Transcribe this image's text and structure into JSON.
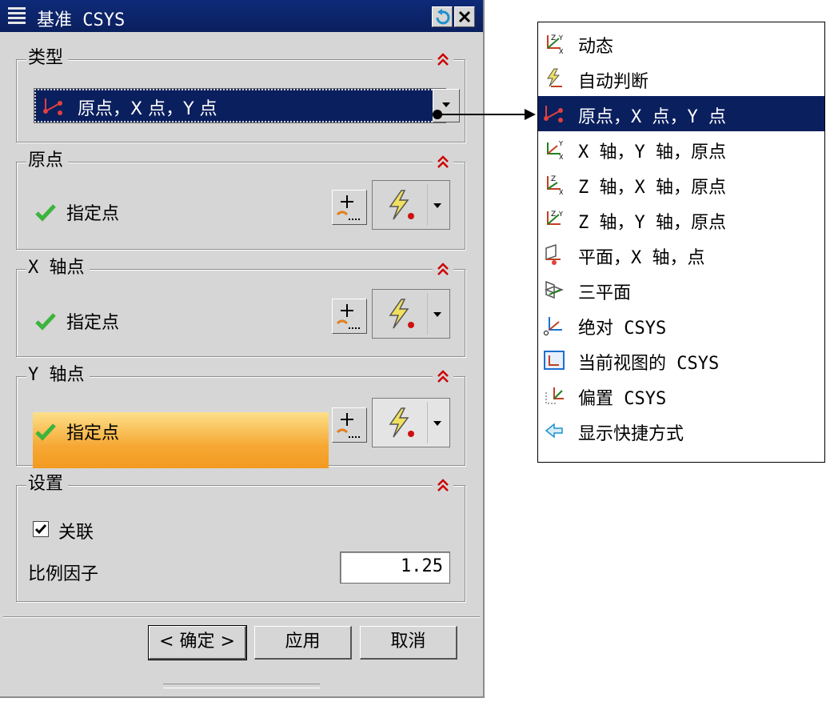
{
  "dialog": {
    "title": "基准 CSYS",
    "type_group": {
      "label": "类型",
      "selected": "原点，X 点，Y 点"
    },
    "origin_group": {
      "label": "原点",
      "row_label": "指定点"
    },
    "xaxis_group": {
      "label": "X 轴点",
      "row_label": "指定点"
    },
    "yaxis_group": {
      "label": "Y 轴点",
      "row_label": "指定点"
    },
    "settings_group": {
      "label": "设置",
      "associative_label": "关联",
      "associative_checked": true,
      "scale_label": "比例因子",
      "scale_value": "1.25"
    },
    "buttons": {
      "ok": "< 确定 >",
      "apply": "应用",
      "cancel": "取消"
    }
  },
  "type_dropdown": {
    "items": [
      {
        "label": "动态",
        "icon": "dynamic-csys-icon"
      },
      {
        "label": "自动判断",
        "icon": "inferred-icon"
      },
      {
        "label": "原点，X 点，Y 点",
        "icon": "origin-xpoint-ypoint-icon",
        "selected": true
      },
      {
        "label": "X 轴，Y 轴，原点",
        "icon": "xaxis-yaxis-origin-icon"
      },
      {
        "label": "Z 轴，X 轴，原点",
        "icon": "zaxis-xaxis-origin-icon"
      },
      {
        "label": "Z 轴，Y 轴，原点",
        "icon": "zaxis-yaxis-origin-icon"
      },
      {
        "label": "平面，X 轴，点",
        "icon": "plane-xaxis-point-icon"
      },
      {
        "label": "三平面",
        "icon": "three-planes-icon"
      },
      {
        "label": "绝对 CSYS",
        "icon": "absolute-csys-icon"
      },
      {
        "label": "当前视图的 CSYS",
        "icon": "view-csys-icon"
      },
      {
        "label": "偏置 CSYS",
        "icon": "offset-csys-icon"
      },
      {
        "label": "显示快捷方式",
        "icon": "show-shortcuts-icon"
      }
    ]
  },
  "colors": {
    "titlebar": "#0a1f5e",
    "selection": "#0a1f5e",
    "highlight_orange": "#f6a834",
    "collapse_red": "#cc0000",
    "check_green": "#3cb43c"
  }
}
